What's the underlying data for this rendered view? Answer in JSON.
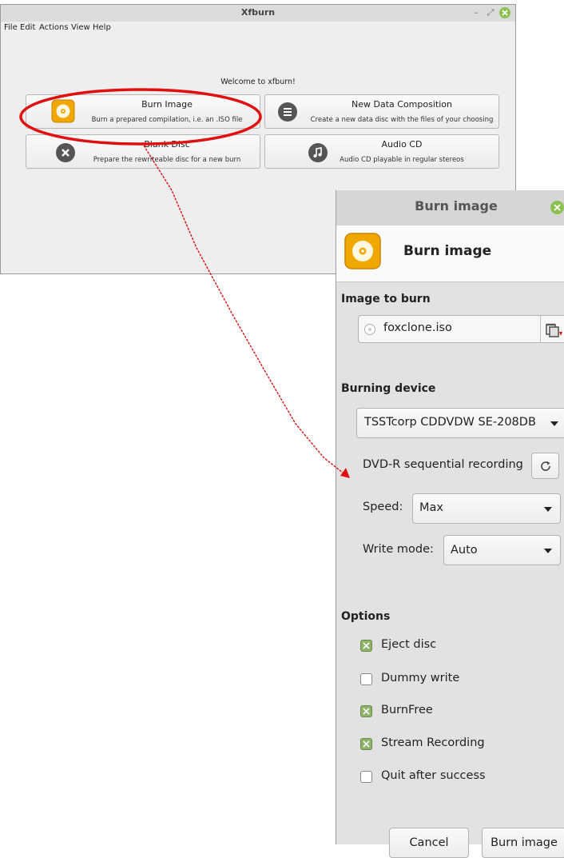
{
  "main_window": {
    "title": "Xfburn",
    "menu": [
      "File",
      "Edit",
      "Actions",
      "View",
      "Help"
    ],
    "welcome": "Welcome to xfburn!",
    "actions": [
      {
        "title": "Burn Image",
        "subtitle": "Burn a prepared compilation, i.e. an .ISO file",
        "icon": "burn-disc-icon"
      },
      {
        "title": "New Data Composition",
        "subtitle": "Create a new data disc with the files of your choosing",
        "icon": "list-icon"
      },
      {
        "title": "Blank Disc",
        "subtitle": "Prepare the rewriteable disc for a new burn",
        "icon": "close-circle-icon"
      },
      {
        "title": "Audio CD",
        "subtitle": "Audio CD playable in regular stereos",
        "icon": "music-note-icon"
      }
    ]
  },
  "dialog": {
    "title": "Burn image",
    "header_title": "Burn image",
    "image_section": "Image to burn",
    "image_file": "foxclone.iso",
    "device_section": "Burning device",
    "device": "TSSTcorp CDDVDW SE-208DB",
    "media_status": "DVD-R sequential recording",
    "speed_label": "Speed:",
    "speed_value": "Max",
    "write_mode_label": "Write mode:",
    "write_mode_value": "Auto",
    "options_section": "Options",
    "options": [
      {
        "label": "Eject disc",
        "checked": true
      },
      {
        "label": "Dummy write",
        "checked": false
      },
      {
        "label": "BurnFree",
        "checked": true
      },
      {
        "label": "Stream Recording",
        "checked": true
      },
      {
        "label": "Quit after success",
        "checked": false
      }
    ],
    "cancel_label": "Cancel",
    "burn_label": "Burn image"
  },
  "colors": {
    "accent_green": "#8cc152",
    "annotation_red": "#e01010",
    "burn_icon": "#f0a800"
  }
}
